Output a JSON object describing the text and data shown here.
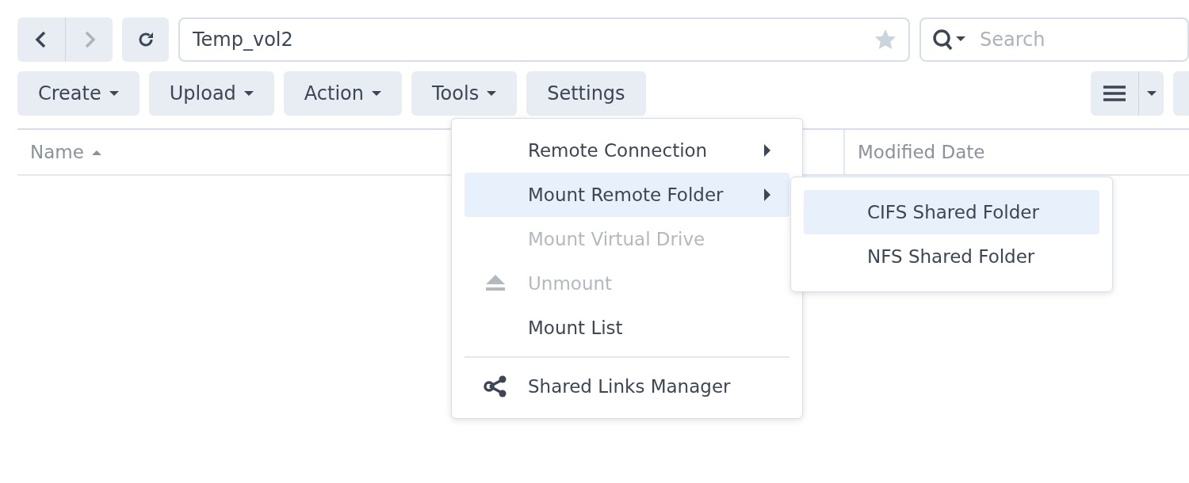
{
  "navigation": {
    "back_disabled": false,
    "forward_disabled": true
  },
  "path_field": {
    "value": "Temp_vol2",
    "favorite": false
  },
  "search": {
    "placeholder": "Search"
  },
  "toolbar": [
    {
      "label": "Create",
      "dropdown": true
    },
    {
      "label": "Upload",
      "dropdown": true
    },
    {
      "label": "Action",
      "dropdown": true
    },
    {
      "label": "Tools",
      "dropdown": true
    },
    {
      "label": "Settings",
      "dropdown": false
    }
  ],
  "table": {
    "columns": [
      {
        "label": "Name",
        "sorted": true
      },
      {
        "label": "Modified Date",
        "sorted": false
      }
    ]
  },
  "tools_menu": [
    {
      "kind": "submenu",
      "label": "Remote Connection",
      "disabled": false,
      "selected": false
    },
    {
      "kind": "submenu",
      "label": "Mount Remote Folder",
      "disabled": false,
      "selected": true
    },
    {
      "kind": "plain",
      "label": "Mount Virtual Drive",
      "disabled": true,
      "selected": false
    },
    {
      "kind": "eject",
      "label": "Unmount",
      "disabled": true,
      "selected": false
    },
    {
      "kind": "plain",
      "label": "Mount List",
      "disabled": false,
      "selected": false
    },
    {
      "kind": "divider"
    },
    {
      "kind": "share",
      "label": "Shared Links Manager",
      "disabled": false,
      "selected": false
    }
  ],
  "submenu": [
    {
      "label": "CIFS Shared Folder",
      "selected": true
    },
    {
      "label": "NFS Shared Folder",
      "selected": false
    }
  ]
}
